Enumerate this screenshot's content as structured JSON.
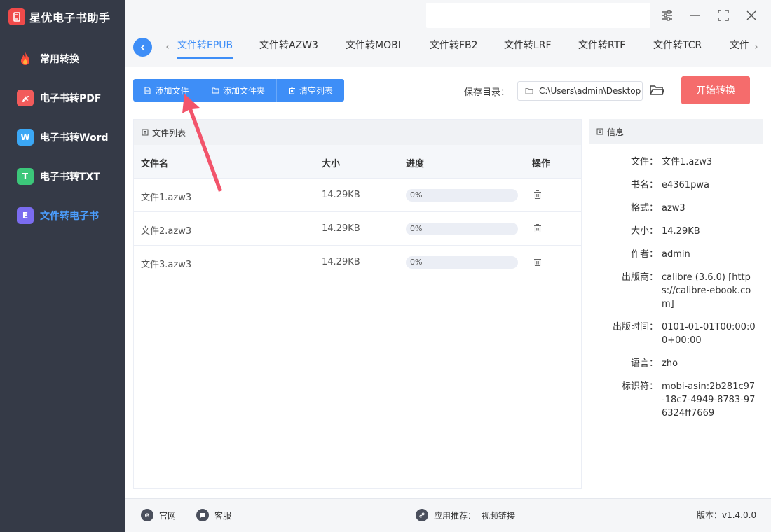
{
  "app": {
    "title": "星优电子书助手"
  },
  "sidebar": {
    "items": [
      {
        "label": "常用转换",
        "icon": "flame-icon",
        "color": "#ff5a3c"
      },
      {
        "label": "电子书转PDF",
        "icon": "pdf-icon",
        "color": "#f25b5b"
      },
      {
        "label": "电子书转Word",
        "icon": "word-icon",
        "glyph": "W",
        "color": "#3ba7f5"
      },
      {
        "label": "电子书转TXT",
        "icon": "txt-icon",
        "glyph": "T",
        "color": "#3cc77a"
      },
      {
        "label": "文件转电子书",
        "icon": "ebook-icon",
        "glyph": "E",
        "color": "#7b6cf0",
        "active": true
      }
    ]
  },
  "tabs": [
    {
      "label": "文件转EPUB",
      "active": true
    },
    {
      "label": "文件转AZW3"
    },
    {
      "label": "文件转MOBI"
    },
    {
      "label": "文件转FB2"
    },
    {
      "label": "文件转LRF"
    },
    {
      "label": "文件转RTF"
    },
    {
      "label": "文件转TCR"
    },
    {
      "label": "文件"
    }
  ],
  "toolbar": {
    "add_file": "添加文件",
    "add_folder": "添加文件夹",
    "clear_list": "清空列表",
    "save_label": "保存目录：",
    "save_path": "C:\\Users\\admin\\Desktop",
    "start": "开始转换"
  },
  "file_list": {
    "title": "文件列表",
    "columns": [
      "文件名",
      "大小",
      "进度",
      "操作"
    ],
    "rows": [
      {
        "name": "文件1.azw3",
        "size": "14.29KB",
        "progress_text": "0%",
        "progress": 0
      },
      {
        "name": "文件2.azw3",
        "size": "14.29KB",
        "progress_text": "0%",
        "progress": 0
      },
      {
        "name": "文件3.azw3",
        "size": "14.29KB",
        "progress_text": "0%",
        "progress": 0
      }
    ]
  },
  "info": {
    "title": "信息",
    "rows": [
      {
        "key": "文件：",
        "value": "文件1.azw3"
      },
      {
        "key": "书名：",
        "value": "e4361pwa"
      },
      {
        "key": "格式：",
        "value": "azw3"
      },
      {
        "key": "大小：",
        "value": "14.29KB"
      },
      {
        "key": "作者：",
        "value": "admin"
      },
      {
        "key": "出版商：",
        "value": "calibre (3.6.0) [https://calibre-ebook.com]"
      },
      {
        "key": "出版时间：",
        "value": "0101-01-01T00:00:00+00:00"
      },
      {
        "key": "语言：",
        "value": "zho"
      },
      {
        "key": "标识符：",
        "value": "mobi-asin:2b281c97-18c7-4949-8783-976324ff7669"
      }
    ]
  },
  "footer": {
    "website": "官网",
    "service": "客服",
    "recommend_label": "应用推荐：",
    "recommend_link": "视频链接",
    "version": "版本：v1.4.0.0"
  },
  "colors": {
    "sidebar_bg": "#353a47",
    "primary": "#3e8ef7",
    "danger": "#f56c6c",
    "arrow": "#f2546b"
  }
}
